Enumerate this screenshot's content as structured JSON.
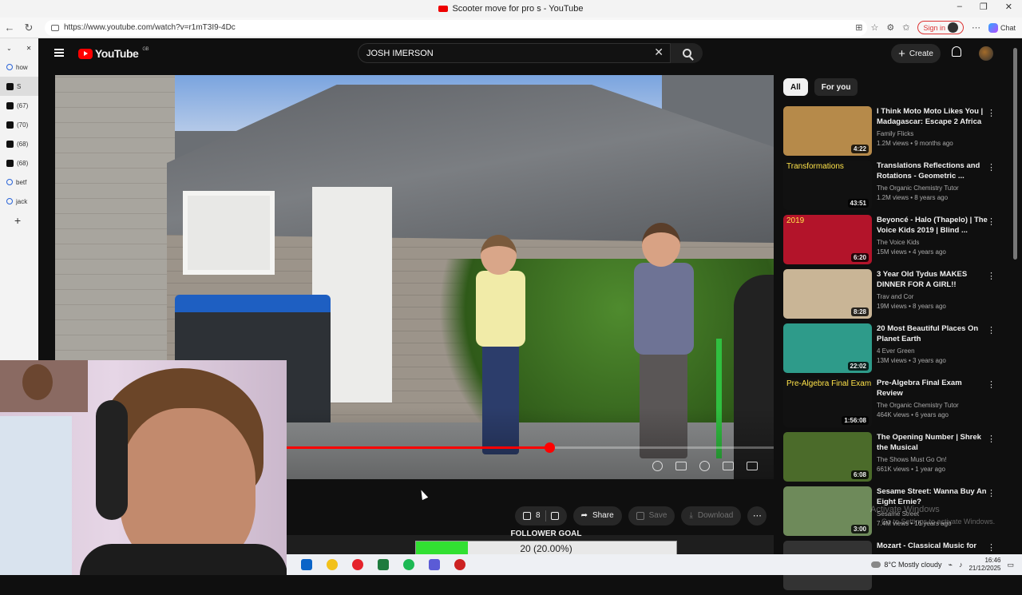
{
  "window": {
    "title": "Scooter move for pro s - YouTube"
  },
  "browser": {
    "url": "https://www.youtube.com/watch?v=r1mT3I9-4Dc",
    "sign_in": "Sign in",
    "chat": "Chat",
    "vertical_tabs": [
      {
        "label": "how",
        "icon": "search-icon"
      },
      {
        "label": "S",
        "icon": "speaker-icon"
      },
      {
        "label": "(67)",
        "icon": "tiktok-icon"
      },
      {
        "label": "(70)",
        "icon": "tiktok-icon"
      },
      {
        "label": "(68)",
        "icon": "tiktok-icon"
      },
      {
        "label": "(68)",
        "icon": "tiktok-icon"
      },
      {
        "label": "betf",
        "icon": "search-icon"
      },
      {
        "label": "jack",
        "icon": "search-icon"
      }
    ]
  },
  "youtube": {
    "logo": "YouTube",
    "region": "GB",
    "search_value": "JOSH IMERSON",
    "create_label": "Create"
  },
  "player": {
    "progress": 0.54
  },
  "actions": {
    "like_count": "8",
    "share": "Share",
    "save": "Save",
    "download": "Download"
  },
  "follower_goal": {
    "label": "FOLLOWER GOAL",
    "text": "20 (20.00%)",
    "fraction": 0.2
  },
  "sidebar": {
    "chips": [
      "All",
      "For you"
    ],
    "videos": [
      {
        "title": "I Think Moto Moto Likes You | Madagascar: Escape 2 Africa ...",
        "channel": "Family Flicks",
        "meta": "1.2M views • 9 months ago",
        "duration": "4:22",
        "color": "#b68a4a"
      },
      {
        "title": "Translations Reflections and Rotations - Geometric ...",
        "channel": "The Organic Chemistry Tutor",
        "meta": "1.2M views • 8 years ago",
        "duration": "43:51",
        "color": "#111111",
        "thumb_text": "Transformations"
      },
      {
        "title": "Beyoncé - Halo (Thapelo) | The Voice Kids 2019 | Blind ...",
        "channel": "The Voice Kids",
        "meta": "15M views • 4 years ago",
        "duration": "6:20",
        "color": "#b3142a",
        "thumb_text": "2019"
      },
      {
        "title": "3 Year Old Tydus MAKES DINNER FOR A GIRL!!",
        "channel": "Trav and Cor",
        "meta": "19M views • 8 years ago",
        "duration": "8:28",
        "color": "#c9b596"
      },
      {
        "title": "20 Most Beautiful Places On Planet Earth",
        "channel": "4 Ever Green",
        "meta": "13M views • 3 years ago",
        "duration": "22:02",
        "color": "#2e9b8a"
      },
      {
        "title": "Pre-Algebra Final Exam Review",
        "channel": "The Organic Chemistry Tutor",
        "meta": "464K views • 6 years ago",
        "duration": "1:56:08",
        "color": "#111111",
        "thumb_text": "Pre-Algebra Final Exam"
      },
      {
        "title": "The Opening Number | Shrek the Musical",
        "channel": "The Shows Must Go On!",
        "meta": "661K views • 1 year ago",
        "duration": "6:08",
        "color": "#4b6b2a"
      },
      {
        "title": "Sesame Street: Wanna Buy An Eight Ernie?",
        "channel": "Sesame Street",
        "meta": "7.4M views • 16 years ago",
        "duration": "3:00",
        "color": "#6e8a5a"
      },
      {
        "title": "Mozart - Classical Music for",
        "channel": "",
        "meta": "",
        "duration": "",
        "color": "#333333"
      }
    ]
  },
  "watermark": {
    "line1": "Activate Windows",
    "line2": "Go to Settings to activate Windows."
  },
  "taskbar": {
    "weather": "8°C  Mostly cloudy",
    "time": "16:46",
    "date": "21/12/2025"
  }
}
